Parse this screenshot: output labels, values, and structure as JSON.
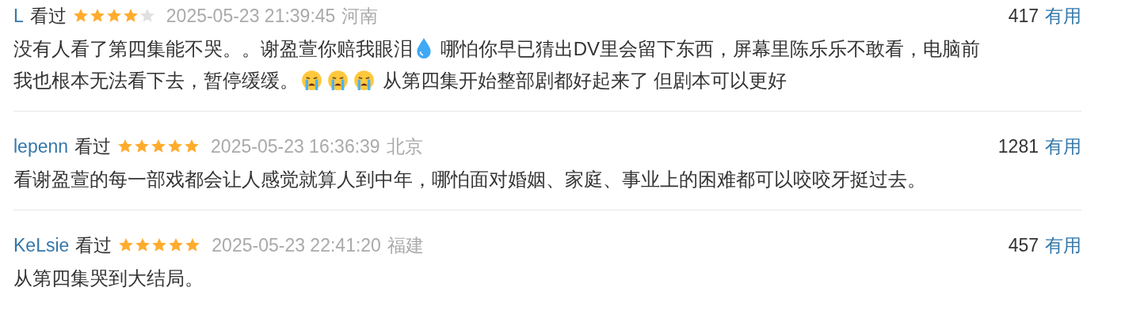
{
  "comments": [
    {
      "user": "L",
      "status": "看过",
      "stars": 4,
      "time": "2025-05-23 21:39:45",
      "location": "河南",
      "votes": "417",
      "vote_label": "有用",
      "content": [
        {
          "kind": "text",
          "text": "没有人看了第四集能不哭。。谢盈萱你赔我眼泪"
        },
        {
          "kind": "drop"
        },
        {
          "kind": "text",
          "text": " 哪怕你早已猜出DV里会留下东西，屏幕里陈乐乐不敢看，电脑前"
        },
        {
          "kind": "text",
          "text": "我也根本无法看下去，暂停缓缓。"
        },
        {
          "kind": "crying"
        },
        {
          "kind": "crying"
        },
        {
          "kind": "crying"
        },
        {
          "kind": "text",
          "text": " 从第四集开始整部剧都好起来了 但剧本可以更好"
        }
      ]
    },
    {
      "user": "lepenn",
      "status": "看过",
      "stars": 5,
      "time": "2025-05-23 16:36:39",
      "location": "北京",
      "votes": "1281",
      "vote_label": "有用",
      "content": [
        {
          "kind": "text",
          "text": "看谢盈萱的每一部戏都会让人感觉就算人到中年，哪怕面对婚姻、家庭、事业上的困难都可以咬咬牙挺过去。"
        }
      ]
    },
    {
      "user": "KeLsie",
      "status": "看过",
      "stars": 5,
      "time": "2025-05-23 22:41:20",
      "location": "福建",
      "votes": "457",
      "vote_label": "有用",
      "content": [
        {
          "kind": "text",
          "text": "从第四集哭到大结局。"
        }
      ]
    }
  ]
}
